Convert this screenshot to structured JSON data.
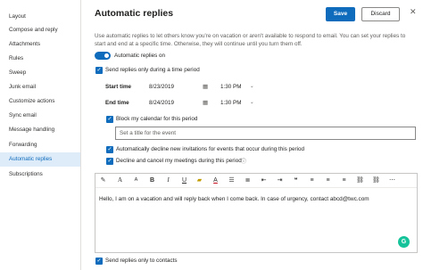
{
  "sidebar": {
    "items": [
      {
        "label": "Layout"
      },
      {
        "label": "Compose and reply"
      },
      {
        "label": "Attachments"
      },
      {
        "label": "Rules"
      },
      {
        "label": "Sweep"
      },
      {
        "label": "Junk email"
      },
      {
        "label": "Customize actions"
      },
      {
        "label": "Sync email"
      },
      {
        "label": "Message handling"
      },
      {
        "label": "Forwarding"
      },
      {
        "label": "Automatic replies",
        "active": true
      },
      {
        "label": "Subscriptions"
      }
    ]
  },
  "header": {
    "title": "Automatic replies",
    "save_label": "Save",
    "discard_label": "Discard",
    "close_glyph": "✕"
  },
  "description": "Use automatic replies to let others know you're on vacation or aren't available to respond to email. You can set your replies to start and end at a specific time. Otherwise, they will continue until you turn them off.",
  "toggle": {
    "label": "Automatic replies on",
    "on": true
  },
  "time_period": {
    "label": "Send replies only during a time period",
    "checked": true
  },
  "start": {
    "label": "Start time",
    "date": "8/23/2019",
    "time": "1:30 PM"
  },
  "end": {
    "label": "End time",
    "date": "8/24/2019",
    "time": "1:30 PM"
  },
  "block_calendar": {
    "label": "Block my calendar for this period",
    "checked": true
  },
  "event_title": {
    "placeholder": "Set a title for the event"
  },
  "decline_invites": {
    "label": "Automatically decline new invitations for events that occur during this period",
    "checked": true
  },
  "decline_cancel": {
    "label": "Decline and cancel my meetings during this period",
    "checked": true
  },
  "editor": {
    "body": "Hello, I am on a vacation and will reply back when I come back. In case of urgency, contact abcd@twc.com",
    "grammarly_glyph": "G"
  },
  "contacts_only": {
    "label": "Send replies only to contacts",
    "checked": true
  },
  "colors": {
    "accent": "#0f6cbd",
    "active_bg": "#deecf9",
    "grammarly": "#15c39a"
  }
}
